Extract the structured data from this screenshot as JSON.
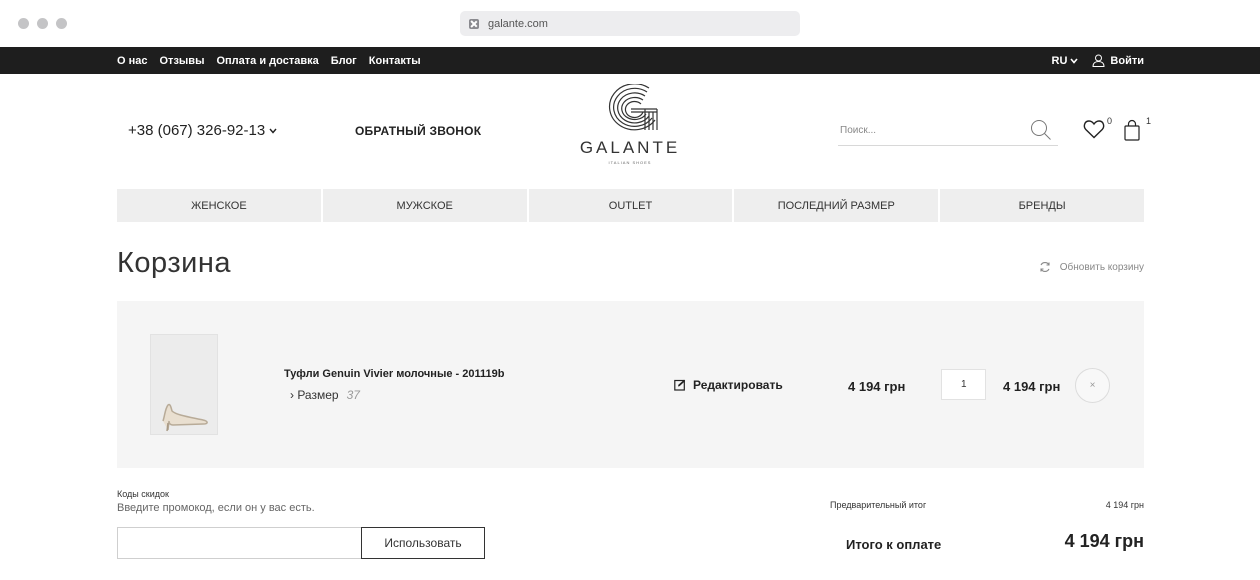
{
  "browser": {
    "url": "galante.com"
  },
  "topbar": {
    "links": [
      "О нас",
      "Отзывы",
      "Оплата и доставка",
      "Блог",
      "Контакты"
    ],
    "language": "RU",
    "login": "Войти"
  },
  "header": {
    "phone": "+38 (067) 326-92-13",
    "callback": "ОБРАТНЫЙ ЗВОНОК",
    "logo_text": "GALANTE",
    "logo_subtitle": "ITALIAN SHOES",
    "search_placeholder": "Поиск...",
    "wishlist_count": "0",
    "cart_count": "1"
  },
  "categories": [
    "ЖЕНСКОЕ",
    "МУЖСКОЕ",
    "OUTLET",
    "ПОСЛЕДНИЙ РАЗМЕР",
    "БРЕНДЫ"
  ],
  "page": {
    "title": "Корзина",
    "refresh": "Обновить корзину"
  },
  "cart": {
    "items": [
      {
        "name": "Туфли Genuin Vivier молочные - 201119b",
        "size_label": "› Размер",
        "size_value": "37",
        "edit": "Редактировать",
        "price": "4 194 грн",
        "quantity": "1",
        "total": "4 194 грн",
        "remove": "×"
      }
    ]
  },
  "promo": {
    "title": "Коды скидок",
    "description": "Введите промокод, если он у вас есть.",
    "input_value": "",
    "button": "Использовать"
  },
  "totals": {
    "subtotal_label": "Предварительный итог",
    "subtotal_value": "4 194 грн",
    "grand_label": "Итого к оплате",
    "grand_value": "4 194 грн"
  }
}
